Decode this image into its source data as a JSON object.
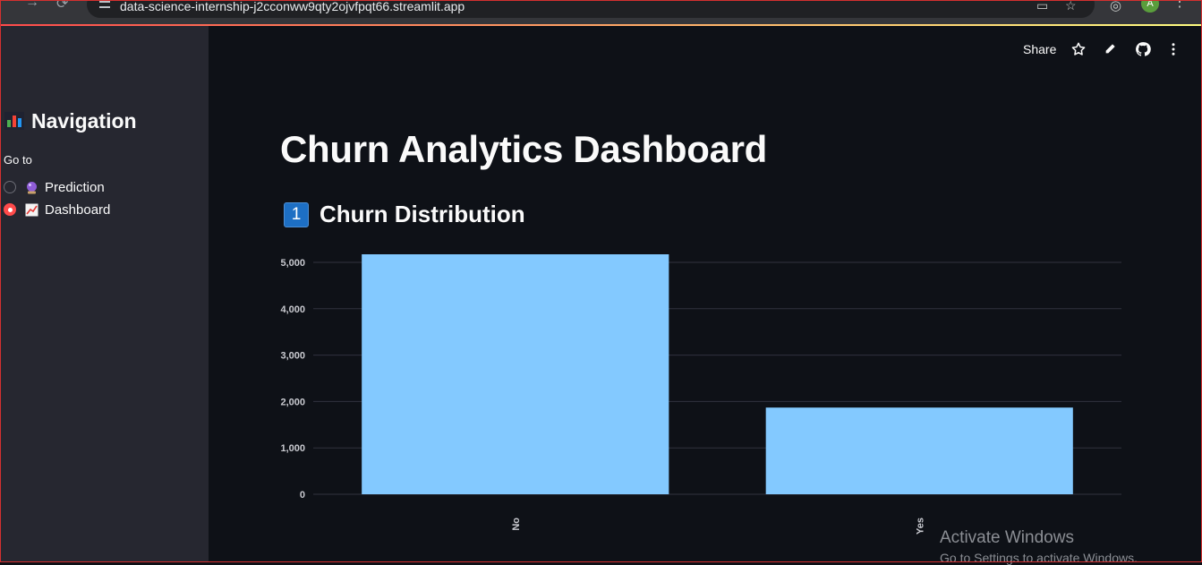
{
  "browser": {
    "url": "data-science-internship-j2cconww9qty2ojvfpqt66.streamlit.app",
    "profile_initial": "A"
  },
  "sidebar": {
    "title": "Navigation",
    "title_icon": "bar-chart-emoji",
    "radio_label": "Go to",
    "options": [
      {
        "label": "Prediction",
        "icon": "crystal-ball-emoji",
        "selected": false
      },
      {
        "label": "Dashboard",
        "icon": "chart-increasing-emoji",
        "selected": true
      }
    ]
  },
  "toolbar": {
    "share_label": "Share",
    "icons": [
      "star-icon",
      "edit-pencil-icon",
      "github-icon",
      "more-vert-icon"
    ]
  },
  "main": {
    "title": "Churn Analytics Dashboard",
    "section": {
      "number_badge": "1",
      "title": "Churn Distribution"
    }
  },
  "chart_data": {
    "type": "bar",
    "categories": [
      "No",
      "Yes"
    ],
    "values": [
      5174,
      1869
    ],
    "ylim": [
      0,
      5174
    ],
    "yticks": [
      0,
      1000,
      2000,
      3000,
      4000,
      5000
    ],
    "ytick_labels": [
      "0",
      "1,000",
      "2,000",
      "3,000",
      "4,000",
      "5,000"
    ],
    "bar_color": "#83c9ff",
    "grid": true
  },
  "watermark": {
    "line1": "Activate Windows",
    "line2": "Go to Settings to activate Windows."
  },
  "colors": {
    "background": "#0e1117",
    "sidebar": "#262730",
    "accent": "#ff4b4b"
  }
}
